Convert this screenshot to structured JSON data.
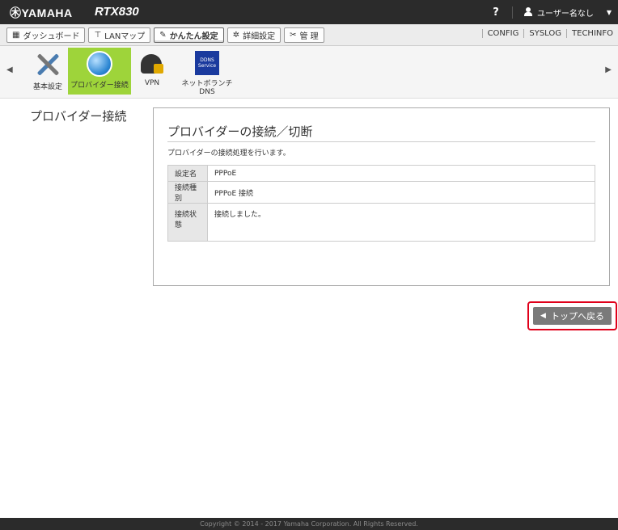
{
  "header": {
    "brand": "㊍YAMAHA",
    "model": "RTX830",
    "help": "?",
    "user": "ユーザー名なし",
    "caret": "▼"
  },
  "menu": {
    "items": [
      {
        "icon": "▦",
        "label": "ダッシュボード"
      },
      {
        "icon": "⊤",
        "label": "LANマップ"
      },
      {
        "icon": "✎",
        "label": "かんたん設定"
      },
      {
        "icon": "✲",
        "label": "詳細設定"
      },
      {
        "icon": "✂",
        "label": "管 理"
      }
    ],
    "links": [
      "CONFIG",
      "SYSLOG",
      "TECHINFO"
    ]
  },
  "iconbar": {
    "left_arrow": "◀",
    "right_arrow": "▶",
    "tiles": [
      {
        "label": "基本設定"
      },
      {
        "label": "プロバイダー接続"
      },
      {
        "label": "VPN"
      },
      {
        "label": "ネットボランチDNS",
        "icon_text": "DDNS Service"
      }
    ]
  },
  "content": {
    "side_title": "プロバイダー接続",
    "panel_title": "プロバイダーの接続／切断",
    "description": "プロバイダーの接続処理を行います。",
    "rows": [
      {
        "label": "設定名",
        "value": "PPPoE"
      },
      {
        "label": "接続種別",
        "value": "PPPoE 接続"
      },
      {
        "label": "接続状態",
        "value": "接続しました。"
      }
    ],
    "back_icon": "◀",
    "back_button": "トップへ戻る"
  },
  "footer": "Copyright © 2014 - 2017 Yamaha Corporation. All Rights Reserved."
}
